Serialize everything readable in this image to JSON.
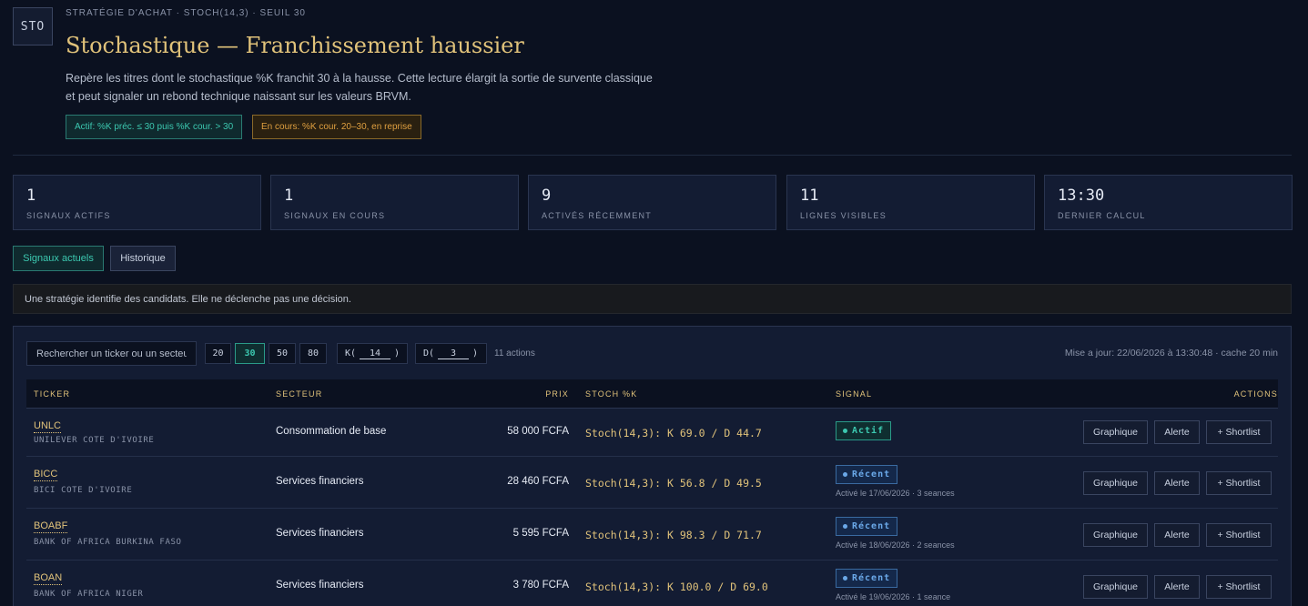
{
  "header": {
    "logo": "STO",
    "eyebrow": "STRATÉGIE D'ACHAT · STOCH(14,3) · SEUIL 30",
    "title": "Stochastique — Franchissement haussier",
    "desc_line1": "Repère les titres dont le stochastique %K franchit 30 à la hausse. Cette lecture élargit la sortie de survente classique",
    "desc_line2": "et peut signaler un rebond technique naissant sur les valeurs BRVM.",
    "chip_active": "Actif: %K préc. ≤ 30 puis %K cour. > 30",
    "chip_pending": "En cours: %K cour. 20–30, en reprise"
  },
  "stats": [
    {
      "value": "1",
      "label": "SIGNAUX ACTIFS"
    },
    {
      "value": "1",
      "label": "SIGNAUX EN COURS"
    },
    {
      "value": "9",
      "label": "ACTIVÉS RÉCEMMENT"
    },
    {
      "value": "11",
      "label": "LIGNES VISIBLES"
    },
    {
      "value": "13:30",
      "label": "DERNIER CALCUL"
    }
  ],
  "tabs": {
    "current": "Signaux actuels",
    "history": "Historique"
  },
  "notice": "Une stratégie identifie des candidats. Elle ne déclenche pas une décision.",
  "toolbar": {
    "search_placeholder": "Rechercher un ticker ou un secteur",
    "levels": [
      "20",
      "30",
      "50",
      "80"
    ],
    "selected_level": "30",
    "k_label": "K(",
    "k_value": "14",
    "d_label": "D(",
    "d_value": "3",
    "close_paren": ")",
    "count": "11 actions",
    "updated": "Mise a jour: 22/06/2026 à 13:30:48 · cache 20 min"
  },
  "table": {
    "headers": {
      "ticker": "TICKER",
      "sector": "SECTEUR",
      "price": "PRIX",
      "stoch": "STOCH %K",
      "signal": "SIGNAL",
      "actions": "ACTIONS"
    },
    "action_labels": {
      "chart": "Graphique",
      "alert": "Alerte",
      "shortlist": "+ Shortlist"
    },
    "rows": [
      {
        "ticker": "UNLC",
        "company": "UNILEVER COTE D'IVOIRE",
        "sector": "Consommation de base",
        "price": "58 000 FCFA",
        "stoch": "Stoch(14,3): K 69.0 / D 44.7",
        "signal": "Actif",
        "signal_type": "actif",
        "activated": ""
      },
      {
        "ticker": "BICC",
        "company": "BICI COTE D'IVOIRE",
        "sector": "Services financiers",
        "price": "28 460 FCFA",
        "stoch": "Stoch(14,3): K 56.8 / D 49.5",
        "signal": "Récent",
        "signal_type": "recent",
        "activated": "Activé le 17/06/2026 · 3 seances"
      },
      {
        "ticker": "BOABF",
        "company": "BANK OF AFRICA BURKINA FASO",
        "sector": "Services financiers",
        "price": "5 595 FCFA",
        "stoch": "Stoch(14,3): K 98.3 / D 71.7",
        "signal": "Récent",
        "signal_type": "recent",
        "activated": "Activé le 18/06/2026 · 2 seances"
      },
      {
        "ticker": "BOAN",
        "company": "BANK OF AFRICA NIGER",
        "sector": "Services financiers",
        "price": "3 780 FCFA",
        "stoch": "Stoch(14,3): K 100.0 / D 69.0",
        "signal": "Récent",
        "signal_type": "recent",
        "activated": "Activé le 19/06/2026 · 1 seance"
      }
    ]
  },
  "colors": {
    "accent_gold": "#e0c27a",
    "accent_teal": "#3cc8b0",
    "accent_blue": "#6aa8e8",
    "background": "#0b1120"
  }
}
